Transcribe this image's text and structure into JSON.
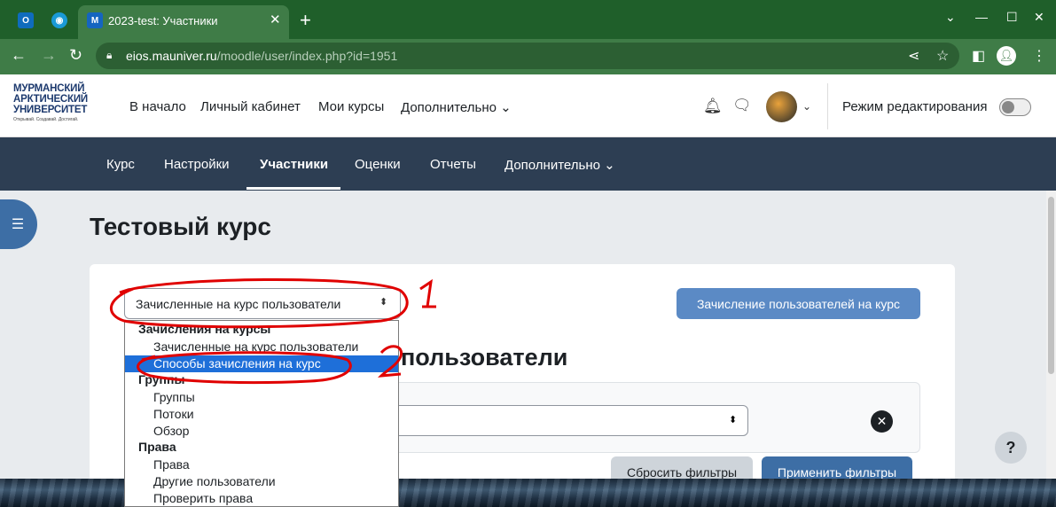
{
  "browser": {
    "tab_title": "2023-test: Участники",
    "tab_close": "✕",
    "new_tab": "+",
    "url_host": "eios.mauniver.ru",
    "url_path": "/moodle/user/index.php?id=1951",
    "win_min": "⌄",
    "win_minimize": "—",
    "win_max": "☐",
    "win_close": "✕",
    "tab_icons": [
      "outlook-icon",
      "app-icon",
      "moodle-icon"
    ]
  },
  "header": {
    "logo": {
      "line1": "МУРМАНСКИЙ",
      "line2": "АРКТИЧЕСКИЙ",
      "line3": "УНИВЕРСИТЕТ",
      "tagline": "Открывай. Создавай. Достигай."
    },
    "nav": [
      "В начало",
      "Личный кабинет",
      "Мои курсы",
      "Дополнительно ⌄"
    ],
    "edit_mode_label": "Режим редактирования"
  },
  "secondary_nav": {
    "items": [
      "Курс",
      "Настройки",
      "Участники",
      "Оценки",
      "Отчеты",
      "Дополнительно ⌄"
    ],
    "active": "Участники"
  },
  "page": {
    "title": "Тестовый курс",
    "select_value": "Зачисленные на курс пользователи",
    "enrol_button": "Зачисление пользователей на курс",
    "heading": "пользователи",
    "reset_filters": "Сбросить фильтры",
    "apply_filters": "Применить фильтры",
    "help": "?"
  },
  "dropdown": {
    "groups": [
      {
        "label": "Зачисления на курсы",
        "options": [
          "Зачисленные на курс пользователи",
          "Способы зачисления на курс"
        ]
      },
      {
        "label": "Группы",
        "options": [
          "Группы",
          "Потоки",
          "Обзор"
        ]
      },
      {
        "label": "Права",
        "options": [
          "Права",
          "Другие пользователи",
          "Проверить права"
        ]
      }
    ],
    "selected": "Способы зачисления на курс"
  },
  "colors": {
    "chrome": "#3f7c47",
    "secnav": "#2d3e53",
    "primary": "#3d6ea5",
    "annotation": "#e00000"
  }
}
